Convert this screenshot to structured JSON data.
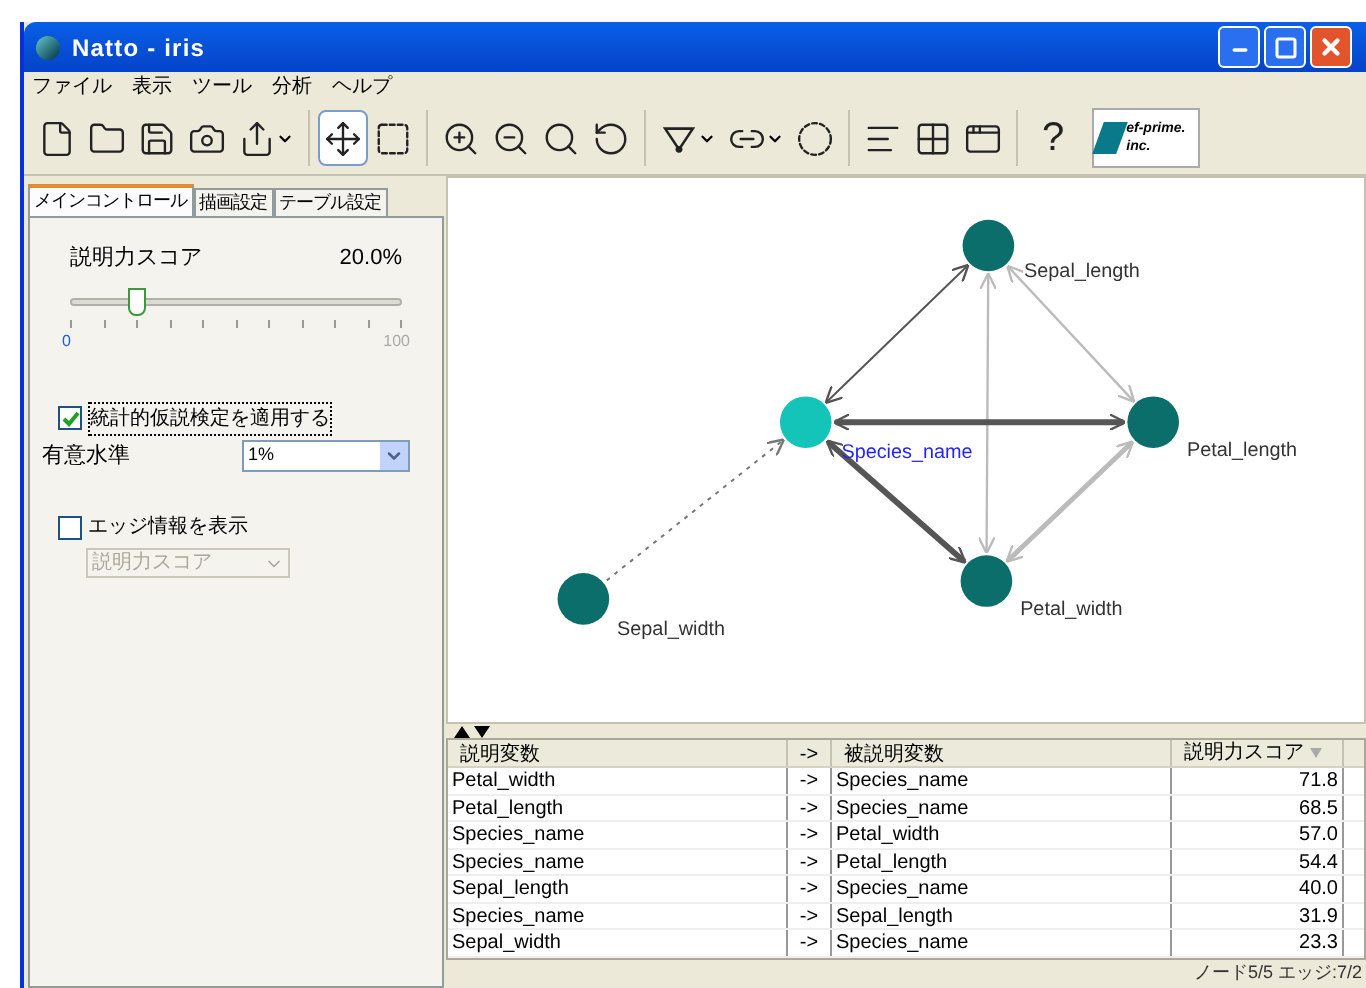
{
  "window": {
    "title": "Natto - iris"
  },
  "menu": [
    "ファイル",
    "表示",
    "ツール",
    "分析",
    "ヘルプ"
  ],
  "toolbar": {
    "move_selected": true,
    "help": "?",
    "logo": {
      "line_1": "ef-prime.",
      "line_2": "inc."
    }
  },
  "tabs": [
    {
      "label": "メインコントロール",
      "selected": true
    },
    {
      "label": "描画設定",
      "selected": false
    },
    {
      "label": "テーブル設定",
      "selected": false
    }
  ],
  "score_slider": {
    "label": "説明力スコア",
    "reading": "20.0%",
    "level": 0.2,
    "min": "0",
    "max": "100"
  },
  "test_checkbox": {
    "label": "統計的仮説検定を適用する",
    "checked": true
  },
  "significance": {
    "label": "有意水準",
    "value": "1%"
  },
  "edge_info_checkbox": {
    "label": "エッジ情報を表示",
    "checked": false
  },
  "edge_info_select": {
    "value": "説明力スコア",
    "disabled": true
  },
  "graph": {
    "nodes": [
      {
        "name": "Sepal_length",
        "selected": false
      },
      {
        "name": "Species_name",
        "selected": true
      },
      {
        "name": "Petal_length",
        "selected": false
      },
      {
        "name": "Petal_width",
        "selected": false
      },
      {
        "name": "Sepal_width",
        "selected": false
      }
    ]
  },
  "table": {
    "columns": [
      "説明変数",
      "->",
      "被説明変数",
      "説明力スコア"
    ],
    "rows": [
      [
        "Petal_width",
        "->",
        "Species_name",
        "71.8"
      ],
      [
        "Petal_length",
        "->",
        "Species_name",
        "68.5"
      ],
      [
        "Species_name",
        "->",
        "Petal_width",
        "57.0"
      ],
      [
        "Species_name",
        "->",
        "Petal_length",
        "54.4"
      ],
      [
        "Sepal_length",
        "->",
        "Species_name",
        "40.0"
      ],
      [
        "Species_name",
        "->",
        "Sepal_length",
        "31.9"
      ],
      [
        "Sepal_width",
        "->",
        "Species_name",
        "23.3"
      ]
    ]
  },
  "status_bar": "ノード5/5 エッジ:7/2"
}
